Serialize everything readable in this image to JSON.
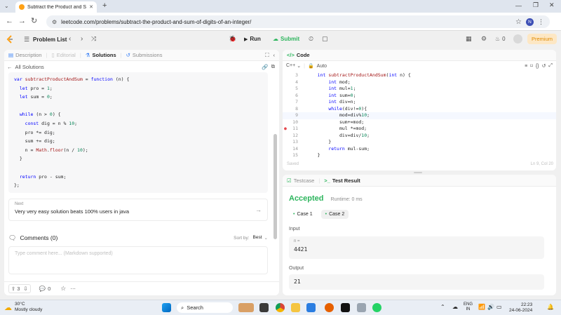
{
  "browser": {
    "tab_title": "Subtract the Product and Sum",
    "url": "leetcode.com/problems/subtract-the-product-and-sum-of-digits-of-an-integer/",
    "profile_initial": "N"
  },
  "toolbar": {
    "problem_list": "Problem List",
    "run": "Run",
    "submit": "Submit",
    "streak": "0",
    "premium": "Premium"
  },
  "left_panel": {
    "tabs": [
      "Description",
      "Editorial",
      "Solutions",
      "Submissions"
    ],
    "back_label": "All Solutions",
    "solution_code": [
      "var subtractProductAndSum = function (n) {",
      "  let pro = 1;",
      "  let sum = 0;",
      "",
      "  while (n > 0) {",
      "    const dig = n % 10;",
      "    pro *= dig;",
      "    sum += dig;",
      "    n = Math.floor(n / 10);",
      "  }",
      "",
      "  return pro - sum;",
      "};"
    ],
    "next_label": "Next",
    "next_title": "Very very easy solution beats 100% users in java",
    "comments_title": "Comments (0)",
    "sort_label": "Sort by:",
    "sort_value": "Best",
    "comment_placeholder": "Type comment here... (Markdown supported)",
    "upvotes": "3",
    "comment_count": "0"
  },
  "code_panel": {
    "title": "Code",
    "language": "C++",
    "mode": "Auto",
    "line_numbers": [
      "3",
      "4",
      "5",
      "6",
      "7",
      "8",
      "9",
      "10",
      "11",
      "12",
      "13",
      "14",
      "15"
    ],
    "lines": [
      "    int subtractProductAndSum(int n) {",
      "        int mod;",
      "        int mul=1;",
      "        int sum=0;",
      "        int div=n;",
      "        while(div!=0){",
      "            mod=div%10;",
      "            sum+=mod;",
      "            mul *=mod;",
      "            div=div/10;",
      "        }",
      "        return mul-sum;",
      "    }"
    ],
    "saved_label": "Saved",
    "cursor_pos": "Ln 9, Col 20"
  },
  "result_panel": {
    "tabs": [
      "Testcase",
      "Test Result"
    ],
    "status": "Accepted",
    "runtime": "Runtime: 0 ms",
    "cases": [
      "Case 1",
      "Case 2"
    ],
    "input_label": "Input",
    "input_var": "n =",
    "input_value": "4421",
    "output_label": "Output",
    "output_value": "21"
  },
  "taskbar": {
    "weather_temp": "30°C",
    "weather_desc": "Mostly cloudy",
    "search_placeholder": "Search",
    "lang": "ENG",
    "region": "IN",
    "time": "22:23",
    "date": "24-06-2024"
  },
  "colors": {
    "accent_green": "#2db55d",
    "accent_orange": "#ffa116",
    "keyword_blue": "#0000ff",
    "string_red": "#a31515"
  }
}
